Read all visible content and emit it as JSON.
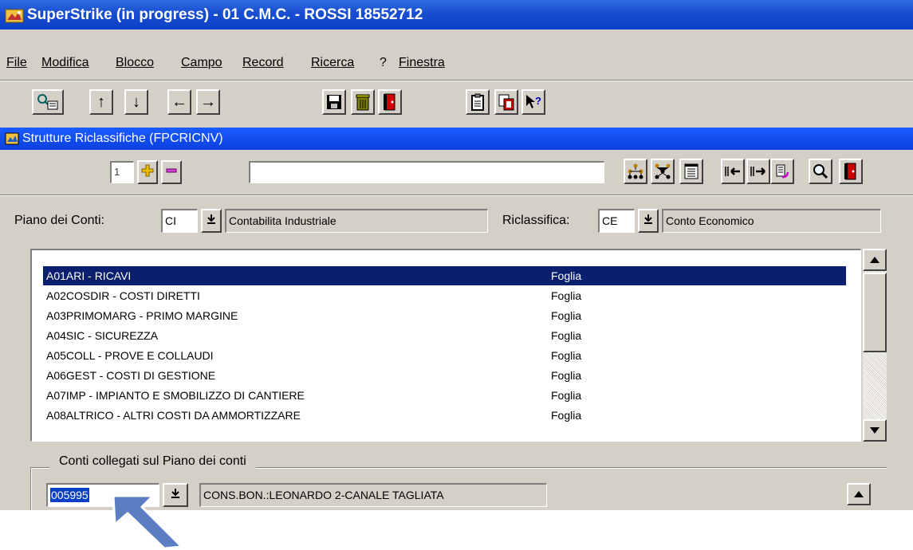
{
  "window": {
    "title": "SuperStrike (in progress) - 01 C.M.C. - ROSSI 18552712"
  },
  "menu": [
    {
      "label": "File"
    },
    {
      "label": "Modifica"
    },
    {
      "label": "Blocco"
    },
    {
      "label": "Campo"
    },
    {
      "label": "Record"
    },
    {
      "label": "Ricerca"
    },
    {
      "label": "?"
    },
    {
      "label": "Finestra"
    }
  ],
  "toolbar": {
    "icons": [
      "enter-query-icon",
      "arrow-up-icon",
      "arrow-down-icon",
      "arrow-left-icon",
      "arrow-right-icon",
      "save-icon",
      "trash-icon",
      "exit-icon",
      "clipboard-icon",
      "copy-icon",
      "help-icon"
    ]
  },
  "form": {
    "title": "Strutture Riclassifiche (FPCRICNV)",
    "record_number": "1",
    "search_value": "",
    "piano_label": "Piano dei Conti:",
    "piano_code": "CI",
    "piano_desc": "Contabilita Industriale",
    "riclassifica_label": "Riclassifica:",
    "riclassifica_code": "CE",
    "riclassifica_desc": "Conto Economico"
  },
  "list": {
    "rows": [
      {
        "code": "A01ARI - RICAVI",
        "type": "Foglia",
        "selected": true
      },
      {
        "code": "A02COSDIR - COSTI DIRETTI",
        "type": "Foglia"
      },
      {
        "code": "A03PRIMOMARG - PRIMO MARGINE",
        "type": "Foglia"
      },
      {
        "code": "A04SIC - SICUREZZA",
        "type": "Foglia"
      },
      {
        "code": "A05COLL - PROVE E COLLAUDI",
        "type": "Foglia"
      },
      {
        "code": "A06GEST - COSTI DI GESTIONE",
        "type": "Foglia"
      },
      {
        "code": "A07IMP - IMPIANTO E SMOBILIZZO DI CANTIERE",
        "type": "Foglia"
      },
      {
        "code": "A08ALTRICO - ALTRI COSTI DA AMMORTIZZARE",
        "type": "Foglia"
      }
    ]
  },
  "linked": {
    "legend": "Conti collegati sul Piano dei conti",
    "code": "005995",
    "desc": "CONS.BON.:LEONARDO 2-CANALE TAGLIATA"
  },
  "colors": {
    "window_bg": "#d4d0c8",
    "title_blue": "#0a3fc8",
    "selection": "#0a1f6e",
    "annotation_arrow": "#5b7fc0"
  }
}
